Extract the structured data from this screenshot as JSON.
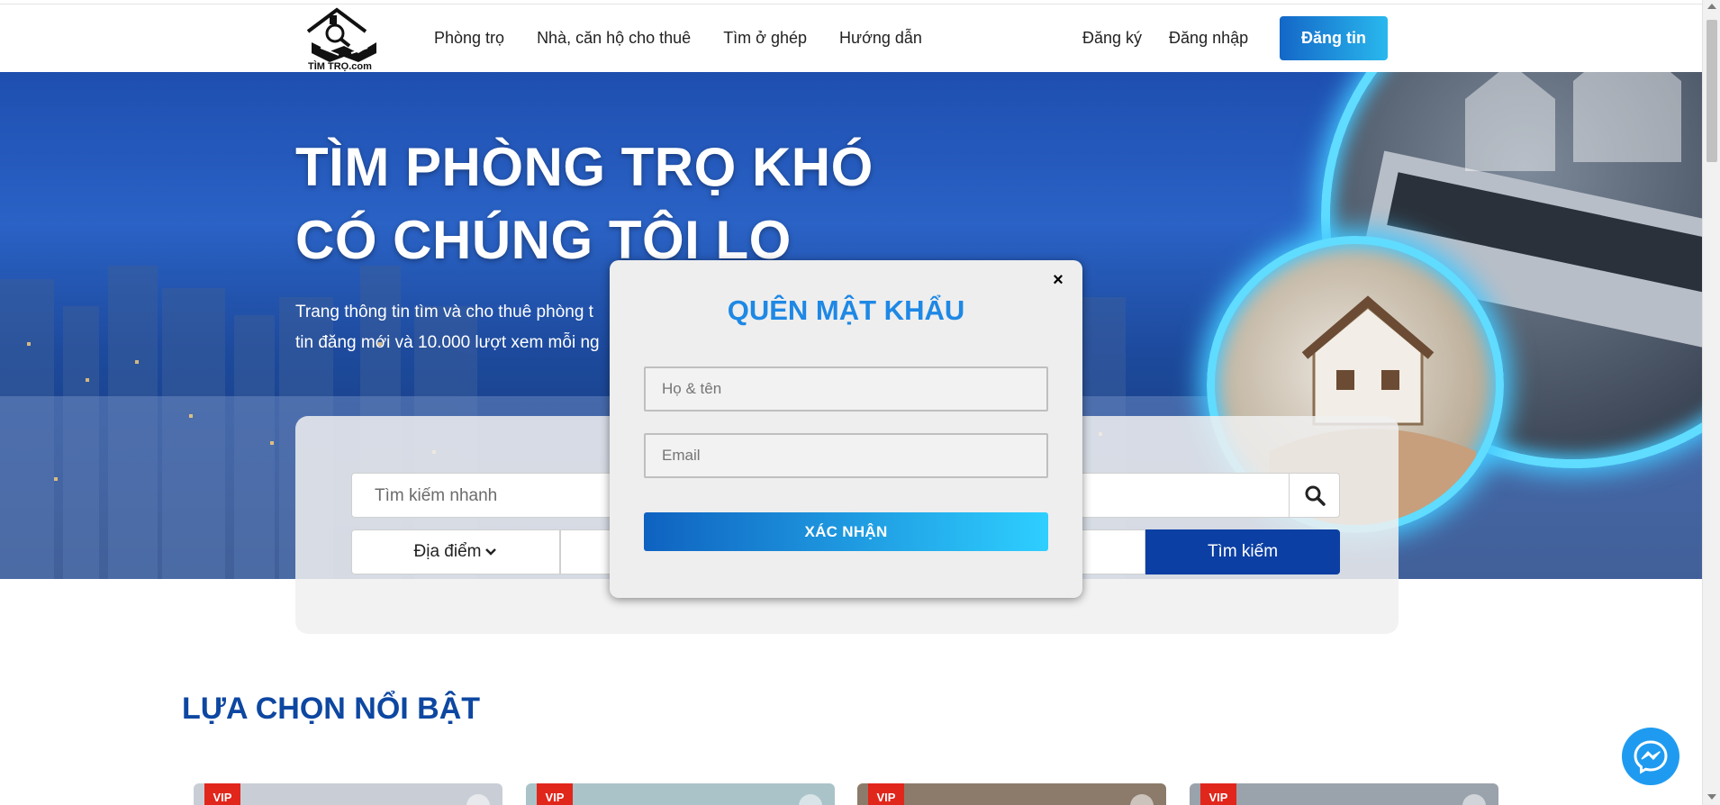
{
  "header": {
    "logo_text": "TÌM TRỌ.com",
    "nav": [
      {
        "label": "Phòng trọ"
      },
      {
        "label": "Nhà, căn hộ cho thuê"
      },
      {
        "label": "Tìm ở ghép"
      },
      {
        "label": "Hướng dẫn"
      }
    ],
    "register_label": "Đăng ký",
    "login_label": "Đăng nhập",
    "post_label": "Đăng tin"
  },
  "hero": {
    "title_line1": "TÌM PHÒNG TRỌ KHÓ",
    "title_line2": "CÓ CHÚNG TÔI LO",
    "subtitle_line1": "Trang thông tin tìm và cho thuê phòng t",
    "subtitle_line2": "tin đăng mới và 10.000 lượt xem mỗi ng"
  },
  "search": {
    "placeholder": "Tìm kiếm nhanh",
    "location_label": "Địa điểm",
    "button_label": "Tìm kiếm",
    "icons": {
      "search": "search-icon",
      "location_chevron": "chevron-down-icon"
    }
  },
  "featured": {
    "title": "LỰA CHỌN NỔI BẬT",
    "cards": [
      {
        "badge": "VIP"
      },
      {
        "badge": "VIP"
      },
      {
        "badge": "VIP"
      },
      {
        "badge": "VIP"
      }
    ]
  },
  "modal": {
    "title": "QUÊN MẬT KHẨU",
    "close_symbol": "×",
    "name_placeholder": "Họ & tên",
    "email_placeholder": "Email",
    "submit_label": "XÁC NHẬN"
  },
  "colors": {
    "brand_blue": "#1e88e5",
    "nav_dark_blue": "#0b3fa3",
    "section_title": "#0d47a1",
    "vip_red": "#e1261c",
    "messenger": "#1e9bf0"
  }
}
